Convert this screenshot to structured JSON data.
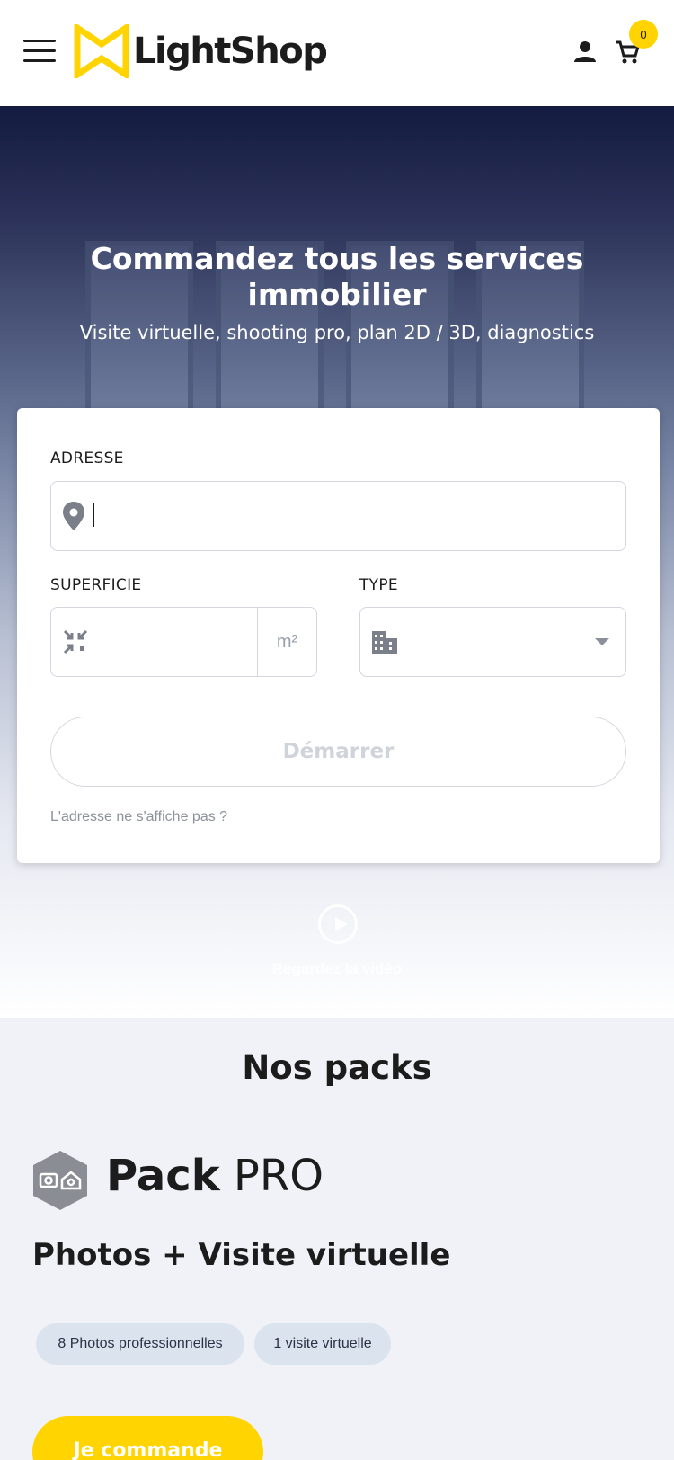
{
  "header": {
    "brand": "LightShop",
    "cart_count": "0"
  },
  "hero": {
    "title": "Commandez tous les services immobilier",
    "subtitle": "Visite virtuelle, shooting pro, plan 2D / 3D, diagnostics",
    "video_link": "Regardez la vidéo"
  },
  "form": {
    "address_label": "ADRESSE",
    "address_value": "",
    "surface_label": "SUPERFICIE",
    "surface_value": "",
    "surface_unit": "m²",
    "type_label": "TYPE",
    "type_value": "",
    "start_label": "Démarrer",
    "address_help": "L'adresse ne s'affiche pas ?"
  },
  "packs": {
    "title": "Nos packs",
    "pack": {
      "name_bold": "Pack",
      "name_rest": "PRO",
      "subtitle": "Photos + Visite virtuelle",
      "features": [
        "8 Photos professionnelles",
        "1 visite virtuelle"
      ],
      "order_label": "Je commande"
    }
  },
  "colors": {
    "accent": "#ffd400",
    "hero_top": "#141b40",
    "background": "#f0f2f8",
    "chip": "#dbe3ef"
  },
  "icons": {
    "menu": "hamburger-icon",
    "logo": "lightshop-logo",
    "user": "user-icon",
    "cart": "cart-icon",
    "address": "map-pin-icon",
    "surface": "compress-icon",
    "type": "building-icon",
    "dropdown": "caret-down-icon",
    "play": "play-icon",
    "pack": "camera-home-hexagon-icon"
  }
}
